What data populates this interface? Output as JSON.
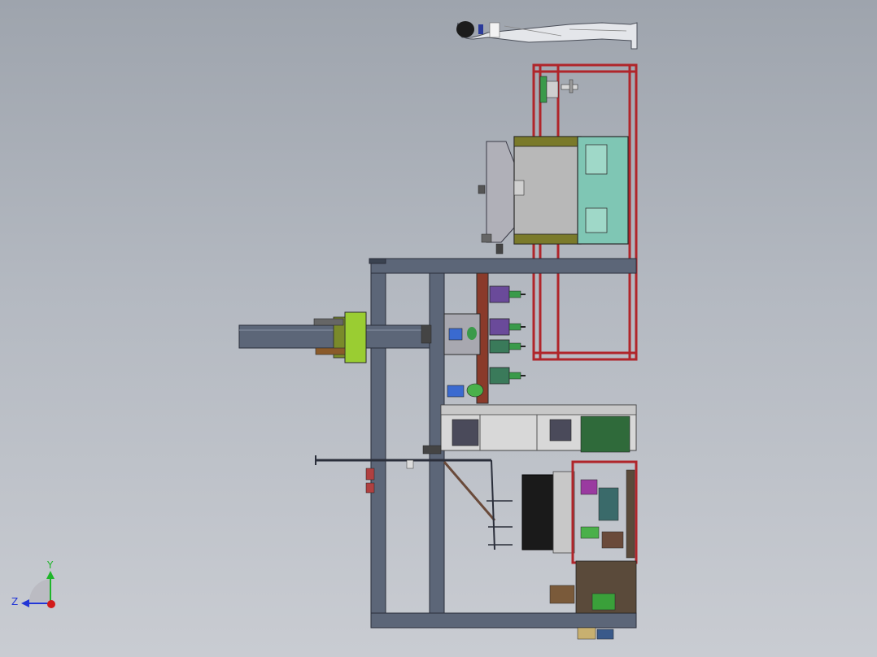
{
  "view": {
    "background_top": "#9ea4ad",
    "background_bottom": "#c9ccd2"
  },
  "triad": {
    "y_label": "Y",
    "z_label": "Z",
    "y_color": "#1fb52a",
    "z_color": "#2236d6",
    "x_color": "#d21a1a"
  },
  "palette": {
    "frame_steel": "#5c6678",
    "frame_edge": "#2a2e3a",
    "red_frame": "#b0252a",
    "teal_panel": "#7fc6b4",
    "gray_panel": "#b8b8b8",
    "olive_bar": "#7a7a2a",
    "rust_bar": "#8a3a2a",
    "purple_part": "#6a4a9a",
    "green_part": "#3a9a4a",
    "blue_part": "#3a6ad0",
    "yellow_green": "#9acd32",
    "dark_block": "#1a1a1a",
    "light_rail": "#d8d8d8"
  }
}
